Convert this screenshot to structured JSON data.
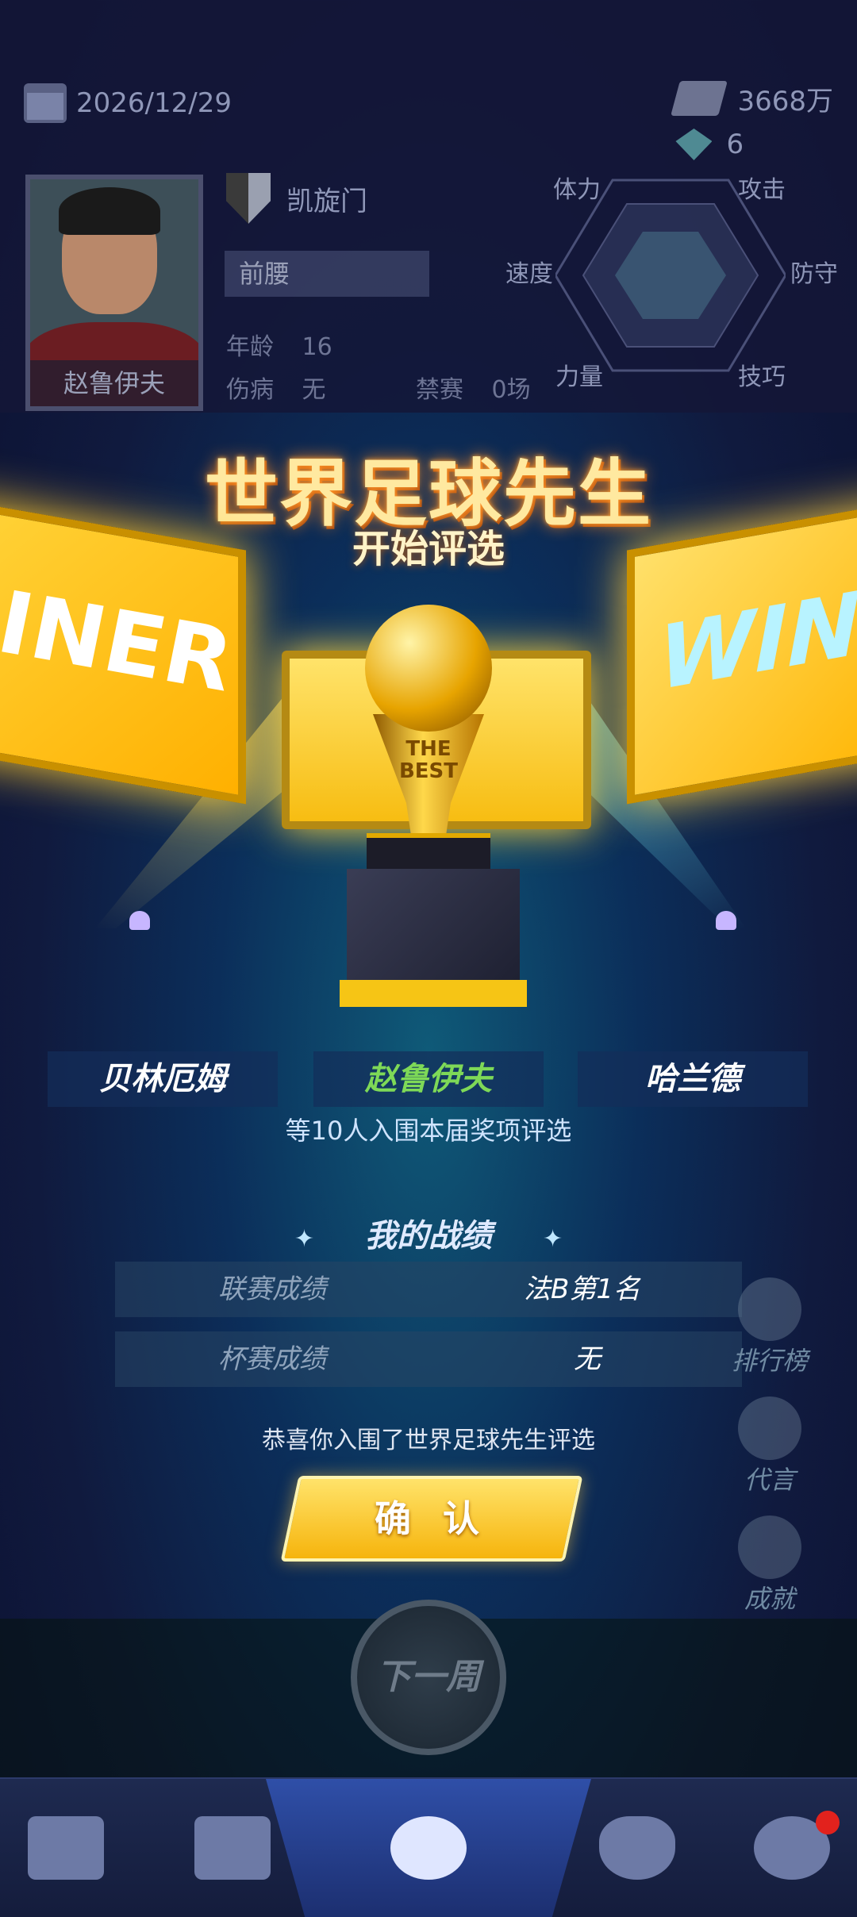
{
  "header": {
    "date": "2026/12/29",
    "money": "3668万",
    "gems": "6"
  },
  "player": {
    "name": "赵鲁伊夫",
    "club": "凯旋门",
    "position": "前腰",
    "age_label": "年龄",
    "age": "16",
    "injury_label": "伤病",
    "injury": "无",
    "suspension_label": "禁赛",
    "suspension": "0场"
  },
  "radar": {
    "stats": [
      "体力",
      "攻击",
      "速度",
      "防守",
      "力量",
      "技巧"
    ]
  },
  "award": {
    "title": "世界足球先生",
    "subtitle": "开始评选",
    "screen_text_left": "INER",
    "screen_text_right": "WINN",
    "trophy_text": "THE BEST",
    "nominees": [
      "贝林厄姆",
      "赵鲁伊夫",
      "哈兰德"
    ],
    "nominee_note": "等10人入围本届奖项评选"
  },
  "record": {
    "title": "我的战绩",
    "rows": [
      {
        "label": "联赛成绩",
        "value": "法B第1名"
      },
      {
        "label": "杯赛成绩",
        "value": "无"
      }
    ],
    "congrats": "恭喜你入围了世界足球先生评选",
    "confirm_label": "确 认"
  },
  "side_menu": [
    "排行榜",
    "代言",
    "成就"
  ],
  "next_week_label": "下一周",
  "colors": {
    "highlight_name": "#7ed957",
    "gold": "#f6c515"
  }
}
